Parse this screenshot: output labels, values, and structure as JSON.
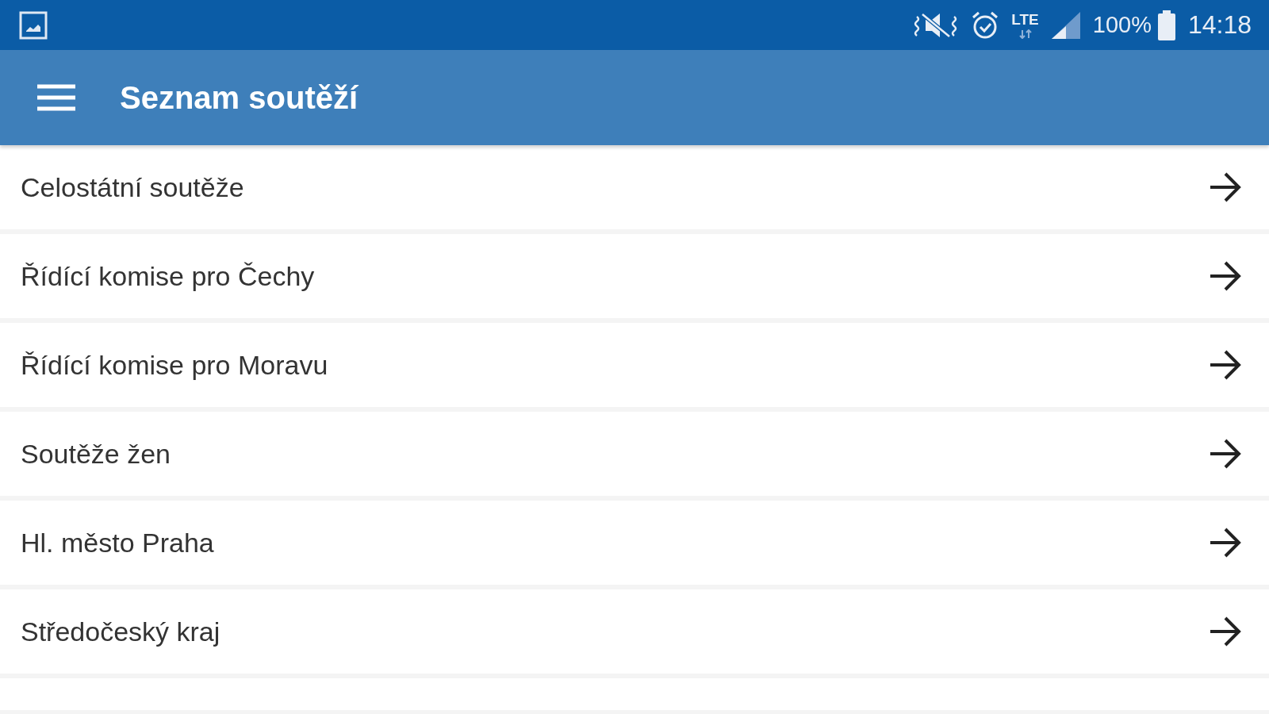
{
  "status_bar": {
    "network": "LTE",
    "battery": "100%",
    "time": "14:18"
  },
  "app_bar": {
    "title": "Seznam soutěží"
  },
  "items": [
    {
      "label": "Celostátní soutěže"
    },
    {
      "label": "Řídící komise pro Čechy"
    },
    {
      "label": "Řídící komise pro Moravu"
    },
    {
      "label": "Soutěže žen"
    },
    {
      "label": "Hl. město Praha"
    },
    {
      "label": "Středočeský kraj"
    }
  ]
}
